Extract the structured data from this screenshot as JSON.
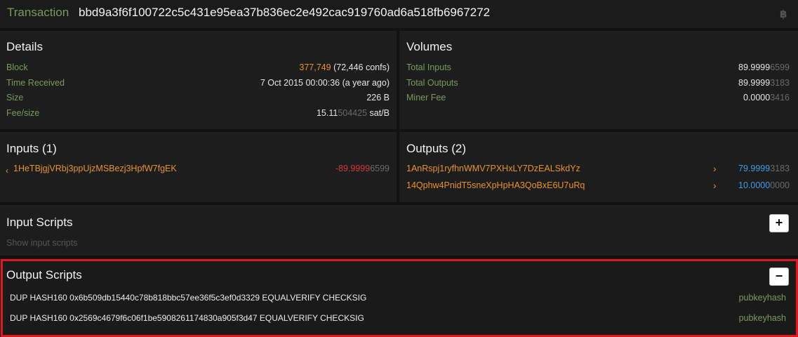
{
  "header": {
    "label": "Transaction",
    "txid": "bbd9a3f6f100722c5c431e95ea37b836ec2e492cac919760ad6a518fb6967272",
    "icon": "bitcoin-icon"
  },
  "details": {
    "title": "Details",
    "block_label": "Block",
    "block_height": "377,749",
    "block_confs": "(72,446 confs)",
    "time_label": "Time Received",
    "time_value": "7 Oct 2015 00:00:36 (a year ago)",
    "size_label": "Size",
    "size_value": "226 B",
    "fee_label": "Fee/size",
    "fee_main": "15.11",
    "fee_dim": "504425",
    "fee_unit": " sat/B"
  },
  "volumes": {
    "title": "Volumes",
    "inputs_label": "Total Inputs",
    "inputs_main": "89.9999",
    "inputs_dim": "6599",
    "outputs_label": "Total Outputs",
    "outputs_main": "89.9999",
    "outputs_dim": "3183",
    "fee_label": "Miner Fee",
    "fee_main": "0.0000",
    "fee_dim": "3416"
  },
  "inputs": {
    "title": "Inputs (1)",
    "items": [
      {
        "arrow": "‹",
        "address": "1HeTBjgjVRbj3ppUjzMSBezj3HpfW7fgEK",
        "amount_main": "-89.9999",
        "amount_dim": "6599"
      }
    ]
  },
  "outputs": {
    "title": "Outputs (2)",
    "items": [
      {
        "address": "1AnRspj1ryfhnWMV7PXHxLY7DzEALSkdYz",
        "arrow": "›",
        "amount_main": "79.9999",
        "amount_dim": "3183"
      },
      {
        "address": "14Qphw4PnidT5sneXpHpHA3QoBxE6U7uRq",
        "arrow": "›",
        "amount_main": "10.0000",
        "amount_dim": "0000"
      }
    ]
  },
  "input_scripts": {
    "title": "Input Scripts",
    "hint": "Show input scripts",
    "toggle": "+"
  },
  "output_scripts": {
    "title": "Output Scripts",
    "toggle": "−",
    "items": [
      {
        "script": "DUP HASH160 0x6b509db15440c78b818bbc57ee36f5c3ef0d3329 EQUALVERIFY CHECKSIG",
        "type": "pubkeyhash"
      },
      {
        "script": "DUP HASH160 0x2569c4679f6c06f1be5908261174830a905f3d47 EQUALVERIFY CHECKSIG",
        "type": "pubkeyhash"
      }
    ]
  },
  "colors": {
    "accent_green": "#7a9a5c",
    "orange": "#e8922c",
    "red": "#d7383a",
    "blue": "#3c9de6",
    "highlight_border": "#e1171e"
  }
}
